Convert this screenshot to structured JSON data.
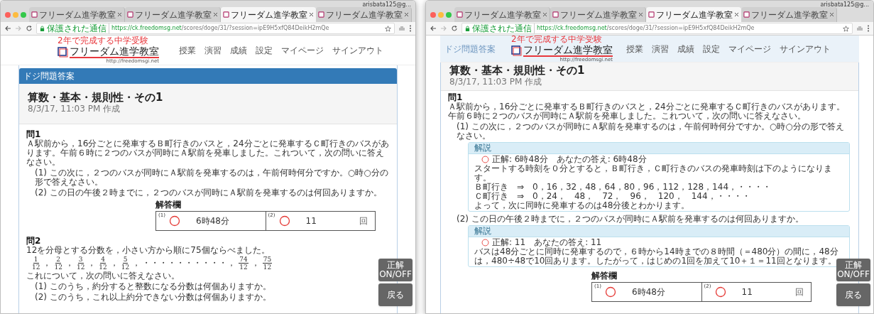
{
  "windows": [
    {
      "tabs": [
        {
          "label": "フリーダム進学教室",
          "selected": false
        },
        {
          "label": "フリーダム進学教室",
          "selected": false
        },
        {
          "label": "フリーダム進学教室",
          "selected": true
        },
        {
          "label": "フリーダム進学教室",
          "selected": false
        }
      ],
      "profile": "arisbata125@g...",
      "secure_label": "保護された通信",
      "url_host": "https://ck.freedomsg.net",
      "url_path": "/scores/doge/31/?session=ipE9H5xfQ84DeikH2mQe",
      "site": {
        "tagline": "2年で完成する中学受験",
        "logo": "フリーダム進学教室",
        "logo_url": "http://freedomsgi.net",
        "nav": [
          "授業",
          "演習",
          "成績",
          "設定",
          "マイページ",
          "サインアウト"
        ]
      },
      "scrolled": false,
      "panel_heading": "ドジ問題答案",
      "title": "算数・基本・規則性・その1",
      "created": "8/3/17, 11:03 PM 作成",
      "questions": [
        {
          "label": "問1",
          "text": "Ａ駅前から，16分ごとに発車するＢ町行きのバスと，24分ごとに発車するＣ町行きのバスがあります。午前６時に２つのバスが同時にＡ駅前を発車しました。これついて，次の問いに答えなさい。",
          "parts": [
            {
              "text": "(1) この次に，２つのバスが同時にＡ駅前を発車するのは，午前何時何分ですか。○時○分の形で答えなさい。"
            },
            {
              "text": "(2) この日の午後２時までに，２つのバスが同時にＡ駅前を発車するのは何回ありますか。"
            }
          ],
          "answer_sheet": {
            "label": "解答欄",
            "cells": [
              {
                "number": "(1)",
                "value": "6時48分",
                "correct": true
              },
              {
                "number": "(2)",
                "value": "11",
                "unit": "回",
                "correct": true
              }
            ]
          }
        },
        {
          "label": "問2",
          "text": "12を分母とする分数を，小さい方から順に75個ならべました。",
          "sequence": [
            {
              "kind": "fraction",
              "num": "1",
              "den": "12",
              "after": "，"
            },
            {
              "kind": "fraction",
              "num": "2",
              "den": "12",
              "after": "，"
            },
            {
              "kind": "fraction",
              "num": "3",
              "den": "12",
              "after": "，"
            },
            {
              "kind": "fraction",
              "num": "4",
              "den": "12",
              "after": "，"
            },
            {
              "kind": "fraction",
              "num": "5",
              "den": "12",
              "after": "，"
            },
            {
              "kind": "text",
              "text": "・・・・・・・・・・，"
            },
            {
              "kind": "fraction",
              "num": "74",
              "den": "12",
              "after": "，"
            },
            {
              "kind": "fraction",
              "num": "75",
              "den": "12"
            }
          ],
          "after_text": "これについて，次の問いに答えなさい。",
          "parts": [
            {
              "text": "(1) このうち，約分すると整数になる分数は何個ありますか。"
            },
            {
              "text": "(2) このうち，これ以上約分できない分数は何個ありますか。"
            }
          ]
        }
      ],
      "buttons": [
        "正解 ON/OFF",
        "戻る"
      ]
    },
    {
      "tabs": [
        {
          "label": "フリーダム進学教室",
          "selected": false
        },
        {
          "label": "フリーダム進学教室",
          "selected": false
        },
        {
          "label": "フリーダム進学教室",
          "selected": true
        },
        {
          "label": "フリーダム進学教室",
          "selected": false
        }
      ],
      "profile": "arisbata125@g...",
      "secure_label": "保護された通信",
      "url_host": "https://ck.freedomsg.net",
      "url_path": "/scores/doge/31/?session=ipE9H5xfQ84DeikH2mQe",
      "site": {
        "tagline": "2年で完成する中学受験",
        "logo": "フリーダム進学教室",
        "logo_url": "http://freedomsgi.net",
        "nav": [
          "授業",
          "演習",
          "成績",
          "設定",
          "マイページ",
          "サインアウト"
        ]
      },
      "scrolled": true,
      "panel_heading": "ドジ問題答案",
      "title": "算数・基本・規則性・その1",
      "created": "8/3/17, 11:03 PM 作成",
      "questions": [
        {
          "label": "問1",
          "text": "Ａ駅前から，16分ごとに発車するＢ町行きのバスと，24分ごとに発車するＣ町行きのバスがあります。午前６時に２つのバスが同時にＡ駅前を発車しました。これついて，次の問いに答えなさい。",
          "parts": [
            {
              "text": "(1) この次に，２つのバスが同時にＡ駅前を発車するのは，午前何時何分ですか。○時○分の形で答えなさい。",
              "explanation": {
                "heading": "解説",
                "correct": true,
                "result": "正解: 6時48分　あなたの答え: 6時48分",
                "lines": [
                  "スタートする時刻を０分とすると，Ｂ町行き，Ｃ町行きのバスの発車時刻は下のようになります。",
                  "Ｂ町行き　⇒　0，16，32，48，64，80，96，112，128，144，・・・・",
                  "Ｃ町行き　⇒　0，24，　48，　72，　96，　120，　144，・・・・",
                  "よって，次に同時に発車するのは48分後とわかります。"
                ]
              }
            },
            {
              "text": "(2) この日の午後２時までに，２つのバスが同時にＡ駅前を発車するのは何回ありますか。",
              "explanation": {
                "heading": "解説",
                "correct": true,
                "result": "正解: 11　あなたの答え: 11",
                "lines": [
                  "バスは48分ごとに同時に発車するので，６時から14時までの８時間（＝480分）の間に，48分は，480÷48で10回あります。したがって，はじめの1回を加えて10＋１＝11回となります。"
                ]
              }
            }
          ],
          "answer_sheet": {
            "label": "解答欄",
            "cells": [
              {
                "number": "(1)",
                "value": "6時48分",
                "correct": true
              },
              {
                "number": "(2)",
                "value": "11",
                "unit": "回",
                "correct": true
              }
            ]
          }
        }
      ],
      "buttons": [
        "正解 ON/OFF",
        "戻る"
      ]
    }
  ]
}
